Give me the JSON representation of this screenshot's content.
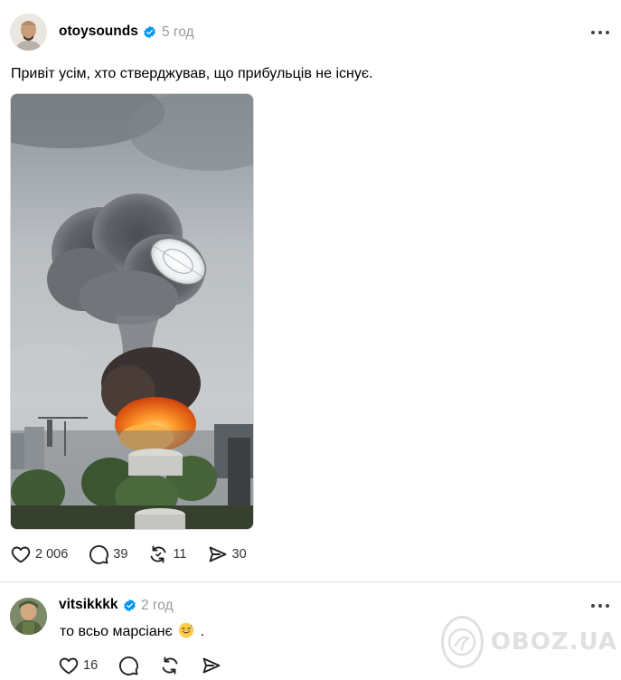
{
  "post": {
    "username": "otoysounds",
    "time": "5 год",
    "text": "Привіт усім, хто стверджував, що прибульців не існує.",
    "media_description_icon": "photo",
    "actions": {
      "like_count": "2 006",
      "comment_count": "39",
      "repost_count": "11",
      "share_count": "30"
    }
  },
  "reply": {
    "username": "vitsikkkk",
    "time": "2 год",
    "text_before_emoji": "то всьо марсіанє",
    "text_after_emoji": ".",
    "emoji_icon": "sweat-smile-icon",
    "actions": {
      "like_count": "16"
    }
  },
  "watermark": {
    "text": "OBOZ.UA"
  },
  "colors": {
    "verified_blue": "#0095f6",
    "muted_text": "#999999",
    "icon_color": "#222222"
  }
}
